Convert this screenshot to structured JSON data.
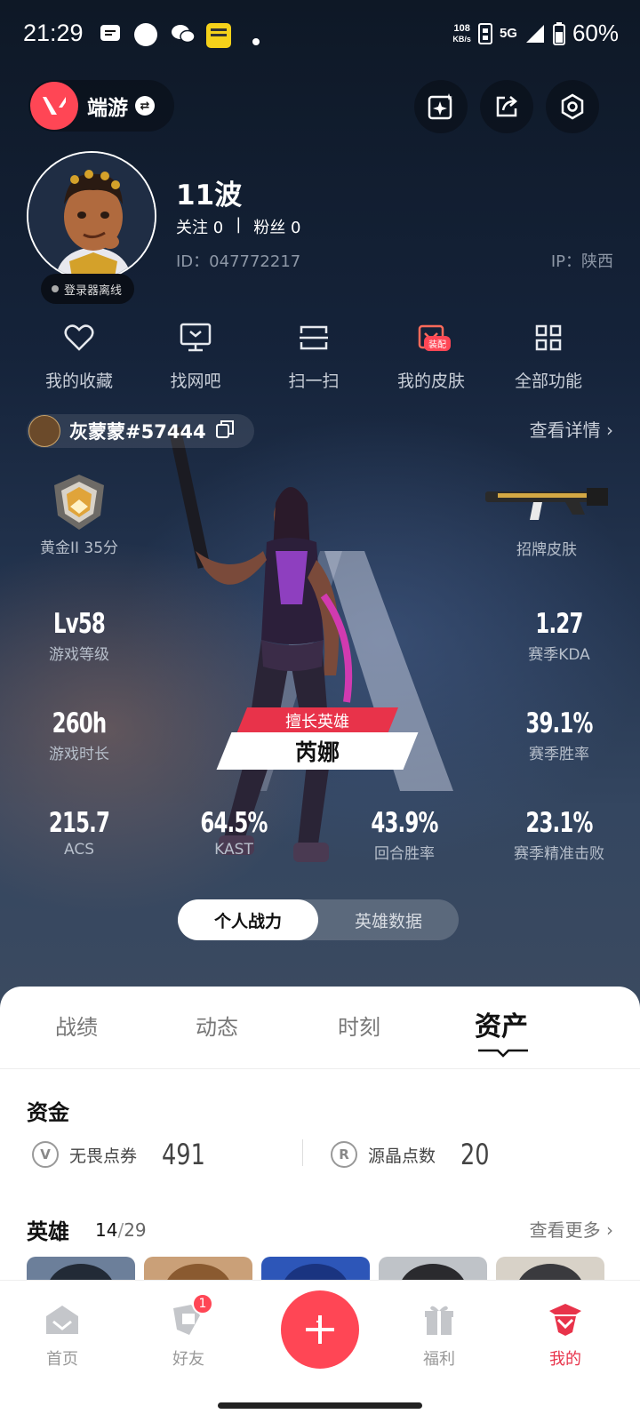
{
  "status_bar": {
    "time": "21:29",
    "net_speed_value": "108",
    "net_speed_unit": "KB/s",
    "network": "5G",
    "battery": "60%"
  },
  "header": {
    "game_name": "端游",
    "icons": [
      "swap-icon",
      "ai-card-icon",
      "share-icon",
      "settings-icon"
    ]
  },
  "profile": {
    "username": "11波",
    "follow_label": "关注",
    "follow_count": "0",
    "fans_label": "粉丝",
    "fans_count": "0",
    "id_text": "ID：047772217",
    "ip_text": "IP：陕西",
    "status": "登录器离线"
  },
  "quick_actions": [
    {
      "label": "我的收藏",
      "icon": "heart-icon"
    },
    {
      "label": "找网吧",
      "icon": "monitor-icon"
    },
    {
      "label": "扫一扫",
      "icon": "scan-icon"
    },
    {
      "label": "我的皮肤",
      "icon": "skin-icon",
      "badge": "装配"
    },
    {
      "label": "全部功能",
      "icon": "grid-icon"
    }
  ],
  "riot": {
    "name": "灰蒙蒙#57444",
    "detail_link": "查看详情"
  },
  "stats": {
    "rank": "黄金II 35分",
    "signature_skin": "招牌皮肤",
    "level_value": "Lv58",
    "level_label": "游戏等级",
    "kda_value": "1.27",
    "kda_label": "赛季KDA",
    "hours_value": "260h",
    "hours_label": "游戏时长",
    "winrate_value": "39.1%",
    "winrate_label": "赛季胜率",
    "acs_value": "215.7",
    "acs_label": "ACS",
    "kast_value": "64.5%",
    "kast_label": "KAST",
    "round_win_value": "43.9%",
    "round_win_label": "回合胜率",
    "precision_value": "23.1%",
    "precision_label": "赛季精准击败"
  },
  "best_hero": {
    "tag": "擅长英雄",
    "name": "芮娜"
  },
  "power_toggle": {
    "active": "个人战力",
    "inactive": "英雄数据"
  },
  "tabs": [
    {
      "label": "战绩",
      "active": false
    },
    {
      "label": "动态",
      "active": false
    },
    {
      "label": "时刻",
      "active": false
    },
    {
      "label": "资产",
      "active": true
    }
  ],
  "funds": {
    "title": "资金",
    "vp_label": "无畏点券",
    "vp_value": "491",
    "rp_label": "源晶点数",
    "rp_value": "20"
  },
  "heroes": {
    "title": "英雄",
    "owned": "14",
    "separator": "/",
    "total": "29",
    "more_link": "查看更多"
  },
  "bottom_nav": [
    {
      "label": "首页",
      "icon": "home-icon",
      "active": false
    },
    {
      "label": "好友",
      "icon": "friends-icon",
      "active": false,
      "badge": "1"
    },
    {
      "label": "福利",
      "icon": "gift-icon",
      "active": false
    },
    {
      "label": "我的",
      "icon": "profile-icon",
      "active": true
    }
  ],
  "colors": {
    "accent": "#ff4655",
    "active_nav": "#e8334a"
  }
}
